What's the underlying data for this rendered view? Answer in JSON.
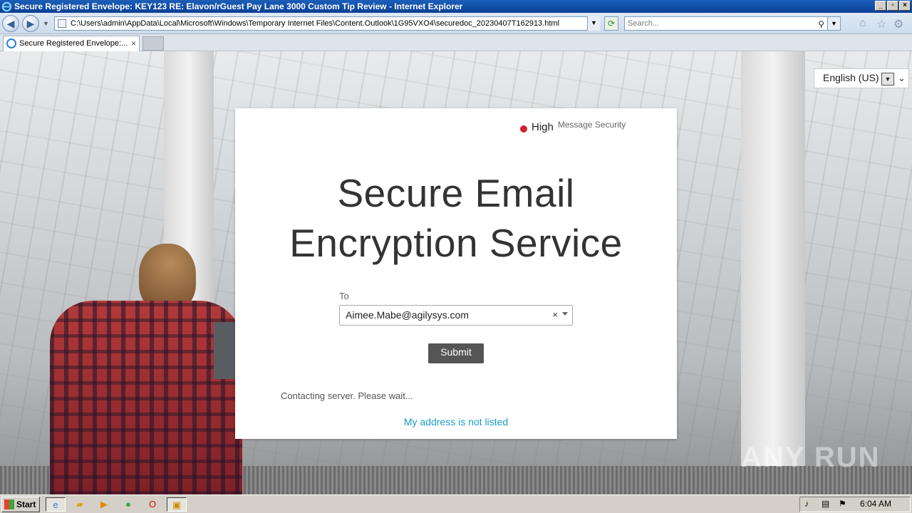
{
  "window": {
    "title": "Secure Registered Envelope: KEY123 RE: Elavon/rGuest Pay Lane 3000 Custom Tip Review - Internet Explorer",
    "controls": [
      "minimize",
      "restore",
      "close"
    ]
  },
  "browser": {
    "address": "C:\\Users\\admin\\AppData\\Local\\Microsoft\\Windows\\Temporary Internet Files\\Content.Outlook\\1G95VXO4\\securedoc_20230407T162913.html",
    "search_placeholder": "Search...",
    "tab_label": "Secure Registered Envelope:..."
  },
  "page": {
    "language": "English (US)",
    "security_level": "High",
    "security_label": "Message Security",
    "heading_line1": "Secure Email",
    "heading_line2": "Encryption Service",
    "to_label": "To",
    "to_value": "Aimee.Mabe@agilysys.com",
    "submit_label": "Submit",
    "status_text": "Contacting server. Please wait...",
    "not_listed_link": "My address is not listed",
    "watermark": "ANY RUN"
  },
  "taskbar": {
    "start_label": "Start",
    "clock": "6:04 AM"
  },
  "colors": {
    "security_dot": "#d0202a",
    "link": "#1a9bc6",
    "submit_bg": "#555555"
  }
}
